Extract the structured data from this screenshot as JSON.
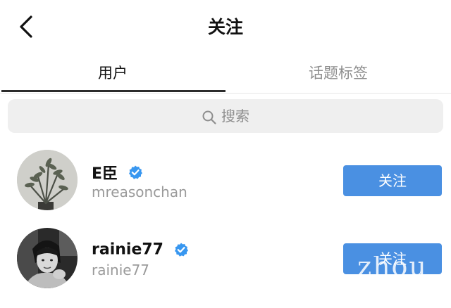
{
  "header": {
    "title": "关注",
    "back_icon": "chevron-left-icon"
  },
  "tabs": [
    {
      "label": "用户",
      "active": true
    },
    {
      "label": "话题标签",
      "active": false
    }
  ],
  "search": {
    "placeholder": "搜索",
    "icon": "search-icon"
  },
  "users": [
    {
      "display_name": "E臣",
      "verified": true,
      "handle": "mreasonchan",
      "follow_label": "关注",
      "avatar": "plant-photo"
    },
    {
      "display_name": "rainie77",
      "verified": true,
      "handle": "rainie77",
      "follow_label": "关注",
      "avatar": "portrait-photo"
    }
  ],
  "watermark": "zhou",
  "colors": {
    "accent": "#4a90e2",
    "verified": "#3897f0",
    "muted_text": "#8e8e8e",
    "search_bg": "#efefef"
  }
}
